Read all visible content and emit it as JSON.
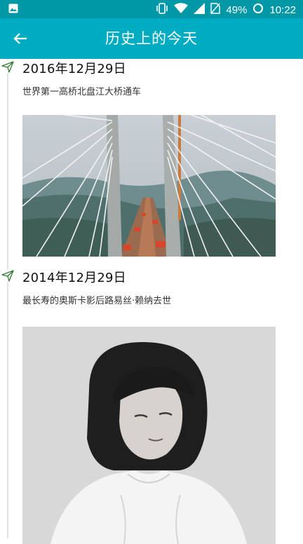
{
  "status_bar": {
    "battery": "49%",
    "time": "10:22",
    "icons": [
      "image-icon",
      "vibrate-icon",
      "wifi-icon",
      "signal-icon",
      "no-sim-icon",
      "battery-icon"
    ]
  },
  "app_bar": {
    "title": "历史上的今天",
    "back_icon": "arrow-left-icon"
  },
  "colors": {
    "status_bar": "#0097a7",
    "app_bar": "#00acc1",
    "timeline_icon": "#2e7d32",
    "timeline_line": "#e3e3e3"
  },
  "entries": [
    {
      "date": "2016年12月29日",
      "description": "世界第一高桥北盘江大桥通车",
      "icon": "send-icon"
    },
    {
      "date": "2014年12月29日",
      "description": "最长寿的奥斯卡影后路易丝·赖纳去世",
      "icon": "send-icon"
    }
  ]
}
